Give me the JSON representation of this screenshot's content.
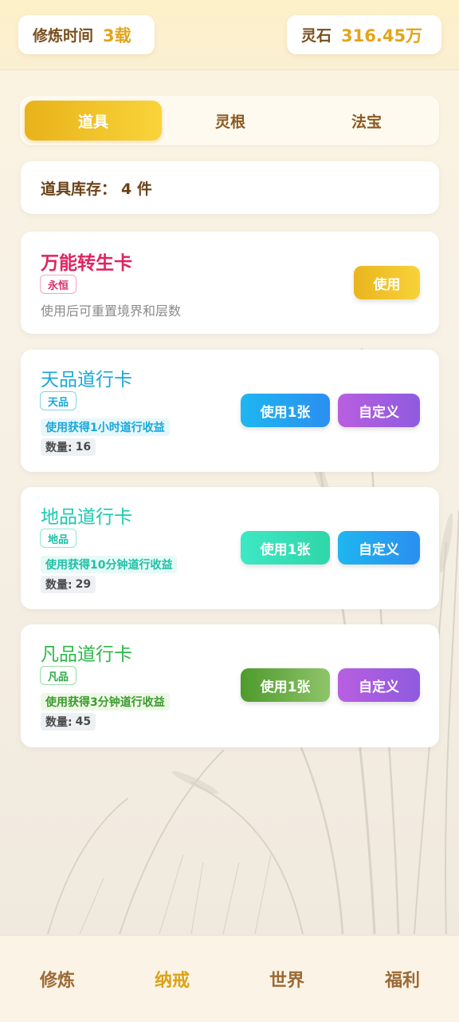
{
  "header": {
    "cultivation_label": "修炼时间",
    "cultivation_value": "3载",
    "stone_label": "灵石",
    "stone_value": "316.45万"
  },
  "tabs": [
    {
      "label": "道具",
      "active": true
    },
    {
      "label": "灵根",
      "active": false
    },
    {
      "label": "法宝",
      "active": false
    }
  ],
  "inventory": {
    "label": "道具库存：",
    "count": "4 件"
  },
  "items": [
    {
      "title": "万能转生卡",
      "tag": "永恒",
      "desc": "使用后可重置境界和层数",
      "use_label": "使用",
      "color": "#e0245e"
    },
    {
      "title": "天品道行卡",
      "tag": "天品",
      "desc": "使用获得1小时道行收益",
      "qty_label": "数量:",
      "qty_value": "16",
      "use_label": "使用1张",
      "custom_label": "自定义",
      "color": "#1aa8d8"
    },
    {
      "title": "地品道行卡",
      "tag": "地品",
      "desc": "使用获得10分钟道行收益",
      "qty_label": "数量:",
      "qty_value": "29",
      "use_label": "使用1张",
      "custom_label": "自定义",
      "color": "#1fc9b0"
    },
    {
      "title": "凡品道行卡",
      "tag": "凡品",
      "desc": "使用获得3分钟道行收益",
      "qty_label": "数量:",
      "qty_value": "45",
      "use_label": "使用1张",
      "custom_label": "自定义",
      "color": "#2fb84a"
    }
  ],
  "nav": [
    {
      "label": "修炼",
      "active": false
    },
    {
      "label": "纳戒",
      "active": true
    },
    {
      "label": "世界",
      "active": false
    },
    {
      "label": "福利",
      "active": false
    }
  ]
}
